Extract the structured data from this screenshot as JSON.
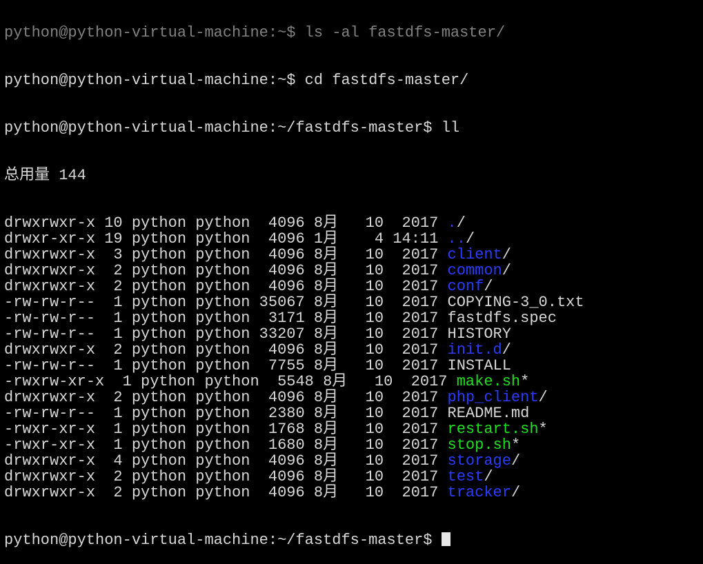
{
  "terminal": {
    "prev_line": "python@python-virtual-machine:~$ ls -al fastdfs-master/",
    "cmd1": "python@python-virtual-machine:~$ cd fastdfs-master/",
    "cmd2": "python@python-virtual-machine:~/fastdfs-master$ ll",
    "total": "总用量 144",
    "entries": [
      {
        "meta": "drwxrwxr-x 10 python python  4096 8月   10  2017 ",
        "name": ".",
        "suffix": "/",
        "kind": "dir"
      },
      {
        "meta": "drwxr-xr-x 19 python python  4096 1月    4 14:11 ",
        "name": "..",
        "suffix": "/",
        "kind": "dir"
      },
      {
        "meta": "drwxrwxr-x  3 python python  4096 8月   10  2017 ",
        "name": "client",
        "suffix": "/",
        "kind": "dir"
      },
      {
        "meta": "drwxrwxr-x  2 python python  4096 8月   10  2017 ",
        "name": "common",
        "suffix": "/",
        "kind": "dir"
      },
      {
        "meta": "drwxrwxr-x  2 python python  4096 8月   10  2017 ",
        "name": "conf",
        "suffix": "/",
        "kind": "dir"
      },
      {
        "meta": "-rw-rw-r--  1 python python 35067 8月   10  2017 ",
        "name": "COPYING-3_0.txt",
        "suffix": "",
        "kind": "file"
      },
      {
        "meta": "-rw-rw-r--  1 python python  3171 8月   10  2017 ",
        "name": "fastdfs.spec",
        "suffix": "",
        "kind": "file"
      },
      {
        "meta": "-rw-rw-r--  1 python python 33207 8月   10  2017 ",
        "name": "HISTORY",
        "suffix": "",
        "kind": "file"
      },
      {
        "meta": "drwxrwxr-x  2 python python  4096 8月   10  2017 ",
        "name": "init.d",
        "suffix": "/",
        "kind": "dir"
      },
      {
        "meta": "-rw-rw-r--  1 python python  7755 8月   10  2017 ",
        "name": "INSTALL",
        "suffix": "",
        "kind": "file"
      },
      {
        "meta": "-rwxrw-xr-x  1 python python  5548 8月   10  2017 ",
        "name": "make.sh",
        "suffix": "*",
        "kind": "exe"
      },
      {
        "meta": "drwxrwxr-x  2 python python  4096 8月   10  2017 ",
        "name": "php_client",
        "suffix": "/",
        "kind": "dir"
      },
      {
        "meta": "-rw-rw-r--  1 python python  2380 8月   10  2017 ",
        "name": "README.md",
        "suffix": "",
        "kind": "file"
      },
      {
        "meta": "-rwxr-xr-x  1 python python  1768 8月   10  2017 ",
        "name": "restart.sh",
        "suffix": "*",
        "kind": "exe"
      },
      {
        "meta": "-rwxr-xr-x  1 python python  1680 8月   10  2017 ",
        "name": "stop.sh",
        "suffix": "*",
        "kind": "exe"
      },
      {
        "meta": "drwxrwxr-x  4 python python  4096 8月   10  2017 ",
        "name": "storage",
        "suffix": "/",
        "kind": "dir"
      },
      {
        "meta": "drwxrwxr-x  2 python python  4096 8月   10  2017 ",
        "name": "test",
        "suffix": "/",
        "kind": "dir"
      },
      {
        "meta": "drwxrwxr-x  2 python python  4096 8月   10  2017 ",
        "name": "tracker",
        "suffix": "/",
        "kind": "dir"
      }
    ],
    "prompt_last": "python@python-virtual-machine:~/fastdfs-master$ "
  },
  "colors": {
    "background": "#000000",
    "text": "#d8d8d8",
    "directory": "#2a3dff",
    "executable": "#1ee01e"
  }
}
